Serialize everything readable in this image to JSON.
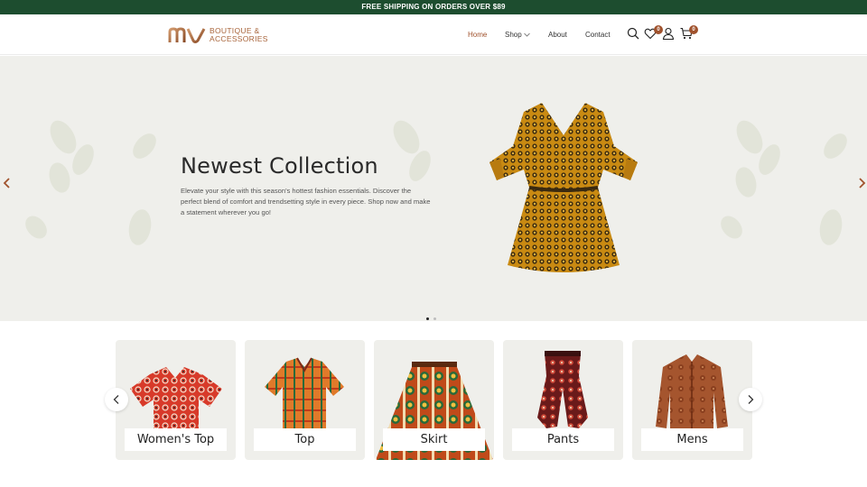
{
  "announcement": "FREE SHIPPING ON ORDERS OVER $89",
  "logo": {
    "mark": "mv-monogram",
    "line1": "BOUTIQUE &",
    "line2": "ACCESSORIES",
    "color": "#a8643a"
  },
  "nav": {
    "items": [
      {
        "label": "Home",
        "active": true
      },
      {
        "label": "Shop",
        "has_dropdown": true
      },
      {
        "label": "About"
      },
      {
        "label": "Contact"
      }
    ]
  },
  "header_icons": {
    "search": "search-icon",
    "wishlist": {
      "icon": "heart-icon",
      "count": "0"
    },
    "account": "user-icon",
    "cart": {
      "icon": "cart-icon",
      "count": "0"
    }
  },
  "hero": {
    "title": "Newest Collection",
    "description": "Elevate your style with this season's hottest fashion essentials. Discover the perfect blend of comfort and trendsetting style in every piece. Shop now and make a statement wherever you go!",
    "image": "african-print-dress",
    "slide_count": 2,
    "active_slide": 1
  },
  "categories": [
    {
      "label": "Women's Top",
      "image": "red-print-blouse"
    },
    {
      "label": "Top",
      "image": "orange-print-shirt"
    },
    {
      "label": "Skirt",
      "image": "print-maxi-skirt"
    },
    {
      "label": "Pants",
      "image": "print-harem-pants"
    },
    {
      "label": "Mens",
      "image": "brown-print-shirt"
    }
  ],
  "colors": {
    "topbar": "#1d4d2f",
    "accent": "#a0522d",
    "hero_bg": "#efefeb",
    "card_bg": "#efefeb"
  }
}
